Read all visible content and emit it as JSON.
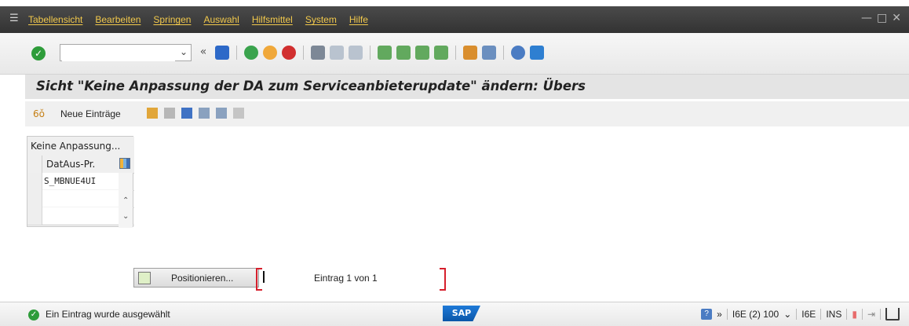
{
  "menubar": {
    "items": [
      "Tabellensicht",
      "Bearbeiten",
      "Springen",
      "Auswahl",
      "Hilfsmittel",
      "System",
      "Hilfe"
    ]
  },
  "toolbar": {
    "command_field_value": ""
  },
  "screen_title": "Sicht \"Keine Anpassung der DA zum Serviceanbieterupdate\" ändern: Übers",
  "app_toolbar": {
    "new_entries_label": "Neue Einträge"
  },
  "table": {
    "header": "Keine Anpassung...",
    "column_header": "DatAus-Pr.",
    "rows": [
      "S_MBNUE4UI",
      "",
      ""
    ]
  },
  "position_button_label": "Positionieren...",
  "entry_status": "Eintrag 1 von 1",
  "status_message": "Ein Eintrag wurde ausgewählt",
  "system_info": {
    "session": "I6E (2) 100",
    "system": "I6E",
    "mode": "INS"
  }
}
